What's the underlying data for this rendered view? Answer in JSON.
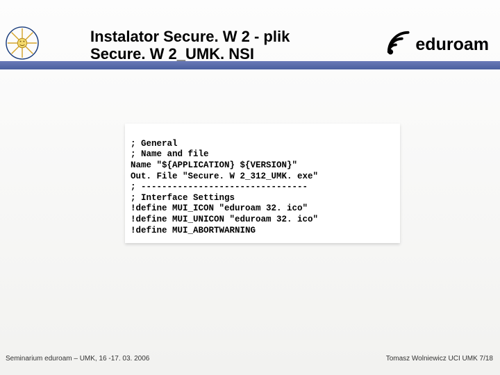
{
  "header": {
    "title_line1": "Instalator Secure. W 2 - plik",
    "title_line2": "Secure. W 2_UMK. NSI",
    "logo_text": "eduroam"
  },
  "code": {
    "l1": "; General",
    "l2": "; Name and file",
    "l3": "Name \"${APPLICATION} ${VERSION}\"",
    "l4": "Out. File \"Secure. W 2_312_UMK. exe\"",
    "l5": "; --------------------------------",
    "l6": "; Interface Settings",
    "l7": "!define MUI_ICON \"eduroam 32. ico\"",
    "l8": "!define MUI_UNICON \"eduroam 32. ico\"",
    "l9": "!define MUI_ABORTWARNING"
  },
  "footer": {
    "left": "Seminarium eduroam – UMK, 16 -17. 03. 2006",
    "right": "Tomasz Wolniewicz UCI UMK 7/18"
  }
}
